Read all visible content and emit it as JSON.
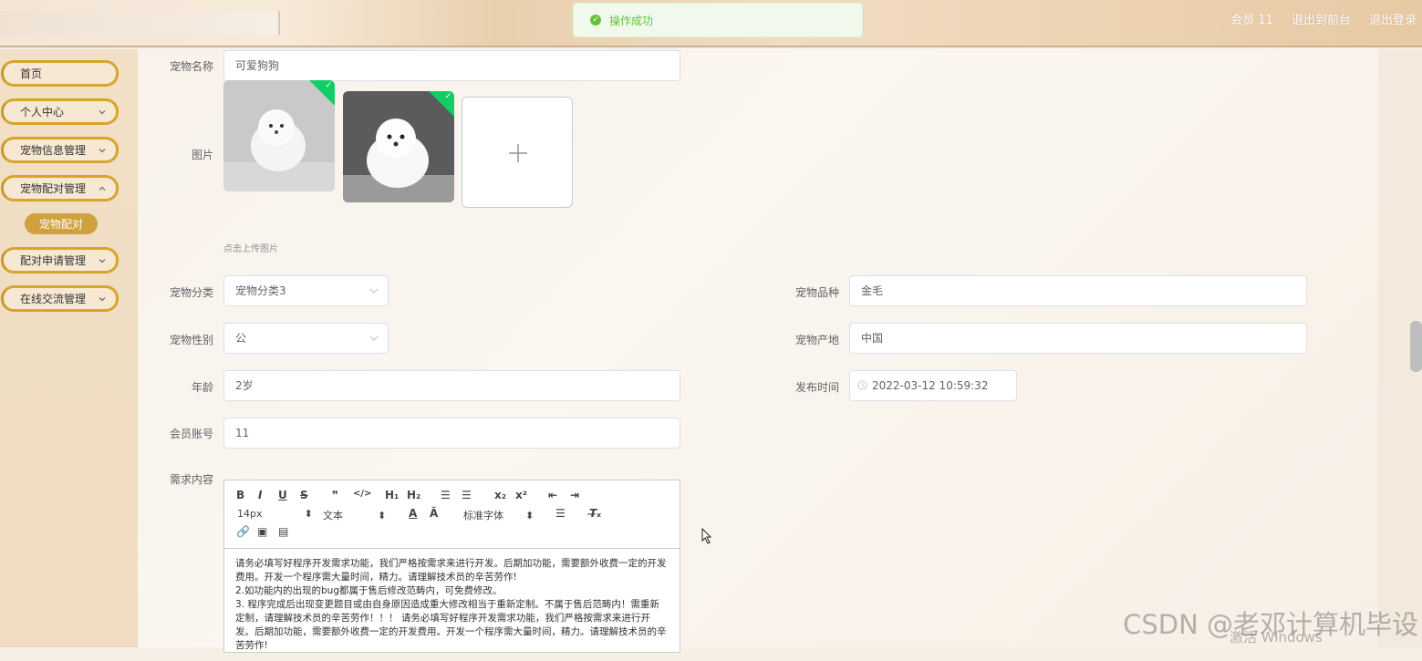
{
  "header": {
    "member_label": "会员 11",
    "exit_front": "退出到前台",
    "logout": "退出登录"
  },
  "toast": {
    "message": "操作成功",
    "color": "#67c23a"
  },
  "sidebar": {
    "items": [
      {
        "label": "首页"
      },
      {
        "label": "个人中心"
      },
      {
        "label": "宠物信息管理"
      },
      {
        "label": "宠物配对管理"
      },
      {
        "label": "配对申请管理"
      },
      {
        "label": "在线交流管理"
      }
    ],
    "active_sub": "宠物配对",
    "accent": "#d6a52c"
  },
  "form": {
    "pet_name_label": "宠物名称",
    "pet_name": "可爱狗狗",
    "image_label": "图片",
    "upload_hint": "点击上传图片",
    "category_label": "宠物分类",
    "category": "宠物分类3",
    "breed_label": "宠物品种",
    "breed": "金毛",
    "gender_label": "宠物性别",
    "gender": "公",
    "origin_label": "宠物产地",
    "origin": "中国",
    "age_label": "年龄",
    "age": "2岁",
    "publish_time_label": "发布时间",
    "publish_time": "2022-03-12 10:59:32",
    "member_account_label": "会员账号",
    "member_account": "11",
    "requirement_label": "需求内容"
  },
  "editor": {
    "font_size": "14px",
    "block_type": "文本",
    "font_family": "标准字体",
    "content": [
      "    请务必填写好程序开发需求功能，我们严格按需求来进行开发。后期加功能，需要额外收费一定的开发费用。开发一个程序需大量时间，精力。请理解技术员的辛苦劳作!",
      "    2.如功能内的出现的bug都属于售后修改范畴内，可免费修改。",
      "3. 程序完成后出现变更题目或由自身原因造成重大修改相当于重新定制。不属于售后范畴内！需重新定制，请理解技术员的辛苦劳作！！！    请务必填写好程序开发需求功能，我们严格按需求来进行开发。后期加功能，需要额外收费一定的开发费用。开发一个程序需大量时间，精力。请理解技术员的辛苦劳作!"
    ]
  },
  "overlay": {
    "watermark": "CSDN @老邓计算机毕设",
    "activate": "激活 Windows"
  }
}
